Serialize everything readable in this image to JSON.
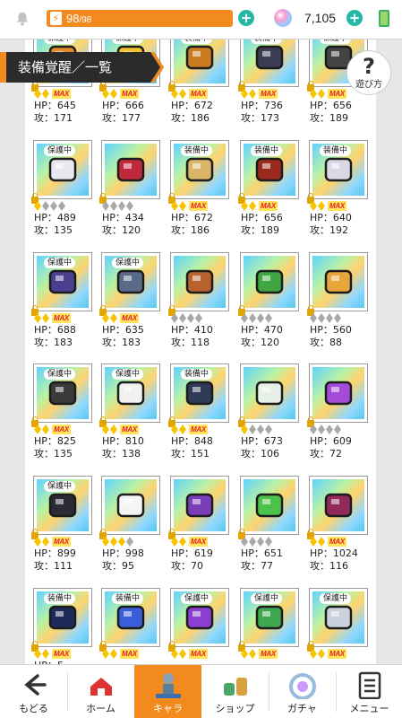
{
  "header": {
    "stamina_current": "98",
    "stamina_max": "/98",
    "stamina_fraction": 1.0,
    "gems": "7,105",
    "accent": "#f28a1e",
    "teal": "#27b7a6"
  },
  "title": "装備覚醒／一覧",
  "help_label": "遊び方",
  "cards": [
    {
      "badge": "保護中",
      "hp": "HP：645",
      "atk": "攻：171",
      "gems": 2,
      "max": true,
      "icon": "staff-icon",
      "tone": "#e58a2b"
    },
    {
      "badge": "保護中",
      "hp": "HP：666",
      "atk": "攻：177",
      "gems": 2,
      "max": true,
      "icon": "cross-staff-icon",
      "tone": "#f2c12e"
    },
    {
      "badge": "装備中",
      "hp": "HP：672",
      "atk": "攻：186",
      "gems": 2,
      "max": true,
      "icon": "axe-icon",
      "tone": "#c97b21"
    },
    {
      "badge": "装備中",
      "hp": "HP：736",
      "atk": "攻：173",
      "gems": 2,
      "max": true,
      "icon": "scythe-icon",
      "tone": "#3c3c54"
    },
    {
      "badge": "保護中",
      "hp": "HP：656",
      "atk": "攻：189",
      "gems": 2,
      "max": true,
      "icon": "hammer-icon",
      "tone": "#444"
    },
    {
      "badge": "保護中",
      "hp": "HP：489",
      "atk": "攻：135",
      "gems": 1,
      "max": false,
      "icon": "wand-icon",
      "tone": "#e8e8f0"
    },
    {
      "badge": "",
      "hp": "HP：434",
      "atk": "攻：120",
      "gems": 0,
      "max": false,
      "icon": "rose-icon",
      "tone": "#c0283c"
    },
    {
      "badge": "装備中",
      "hp": "HP：672",
      "atk": "攻：186",
      "gems": 2,
      "max": true,
      "icon": "round-shield-icon",
      "tone": "#d9b56a"
    },
    {
      "badge": "装備中",
      "hp": "HP：656",
      "atk": "攻：189",
      "gems": 2,
      "max": true,
      "icon": "chest-armor-icon",
      "tone": "#9b2a1e"
    },
    {
      "badge": "装備中",
      "hp": "HP：640",
      "atk": "攻：192",
      "gems": 2,
      "max": true,
      "icon": "gauntlet-icon",
      "tone": "#d9d9e6"
    },
    {
      "badge": "保護中",
      "hp": "HP：688",
      "atk": "攻：183",
      "gems": 2,
      "max": true,
      "icon": "dark-boots-icon",
      "tone": "#4b3f8f"
    },
    {
      "badge": "保護中",
      "hp": "HP：635",
      "atk": "攻：183",
      "gems": 2,
      "max": true,
      "icon": "iron-boots-icon",
      "tone": "#5a6b8a"
    },
    {
      "badge": "",
      "hp": "HP：410",
      "atk": "攻：118",
      "gems": 0,
      "max": false,
      "icon": "bracer-icon",
      "tone": "#b8632d"
    },
    {
      "badge": "",
      "hp": "HP：470",
      "atk": "攻：120",
      "gems": 0,
      "max": false,
      "icon": "bell-charm-icon",
      "tone": "#3fa642"
    },
    {
      "badge": "",
      "hp": "HP：560",
      "atk": "攻：88",
      "gems": 0,
      "max": false,
      "icon": "winged-emblem-icon",
      "tone": "#e8a53a"
    },
    {
      "badge": "保護中",
      "hp": "HP：825",
      "atk": "攻：135",
      "gems": 2,
      "max": true,
      "icon": "crest-shield-icon",
      "tone": "#3b3b3b"
    },
    {
      "badge": "保護中",
      "hp": "HP：810",
      "atk": "攻：138",
      "gems": 2,
      "max": true,
      "icon": "helmet-icon",
      "tone": "#f0f0f0"
    },
    {
      "badge": "装備中",
      "hp": "HP：848",
      "atk": "攻：151",
      "gems": 2,
      "max": true,
      "icon": "wolf-shield-icon",
      "tone": "#2e3a56"
    },
    {
      "badge": "",
      "hp": "HP：673",
      "atk": "攻：106",
      "gems": 1,
      "max": false,
      "icon": "white-armor-icon",
      "tone": "#e6f0e6"
    },
    {
      "badge": "",
      "hp": "HP：609",
      "atk": "攻：72",
      "gems": 0,
      "max": false,
      "icon": "potion-necklace-icon",
      "tone": "#a44ad8"
    },
    {
      "badge": "保護中",
      "hp": "HP：899",
      "atk": "攻：111",
      "gems": 2,
      "max": true,
      "icon": "tower-shield-icon",
      "tone": "#2b2b36"
    },
    {
      "badge": "",
      "hp": "HP：998",
      "atk": "攻：95",
      "gems": 3,
      "max": false,
      "icon": "bouquet-icon",
      "tone": "#f5f5f5"
    },
    {
      "badge": "",
      "hp": "HP：619",
      "atk": "攻：70",
      "gems": 2,
      "max": true,
      "icon": "amethyst-gloves-icon",
      "tone": "#7a3fb8"
    },
    {
      "badge": "",
      "hp": "HP：651",
      "atk": "攻：77",
      "gems": 0,
      "max": false,
      "icon": "green-scroll-icon",
      "tone": "#4cc24c"
    },
    {
      "badge": "",
      "hp": "HP：1024",
      "atk": "攻：116",
      "gems": 2,
      "max": true,
      "icon": "emblem-shield-icon",
      "tone": "#8f2a5a"
    },
    {
      "badge": "装備中",
      "hp": "HP：5",
      "atk": "",
      "gems": 2,
      "max": true,
      "icon": "ring-shield-icon",
      "tone": "#1e2a5a"
    },
    {
      "badge": "装備中",
      "hp": "",
      "atk": "",
      "gems": 2,
      "max": true,
      "icon": "blue-whip-icon",
      "tone": "#3a5ed8"
    },
    {
      "badge": "保護中",
      "hp": "",
      "atk": "",
      "gems": 2,
      "max": true,
      "icon": "amulet-icon",
      "tone": "#8a3fd1"
    },
    {
      "badge": "保護中",
      "hp": "",
      "atk": "",
      "gems": 2,
      "max": true,
      "icon": "vine-charm-icon",
      "tone": "#3fa64f"
    },
    {
      "badge": "保護中",
      "hp": "",
      "atk": "",
      "gems": 2,
      "max": true,
      "icon": "sword-icon",
      "tone": "#c9d2dd"
    }
  ],
  "nav": [
    {
      "label": "もどる",
      "icon": "back-arrow-icon",
      "active": false
    },
    {
      "label": "ホーム",
      "icon": "home-icon",
      "active": false
    },
    {
      "label": "キャラ",
      "icon": "character-icon",
      "active": true
    },
    {
      "label": "ショップ",
      "icon": "shop-icon",
      "active": false
    },
    {
      "label": "ガチャ",
      "icon": "gacha-icon",
      "active": false
    },
    {
      "label": "メニュー",
      "icon": "menu-icon",
      "active": false
    }
  ]
}
